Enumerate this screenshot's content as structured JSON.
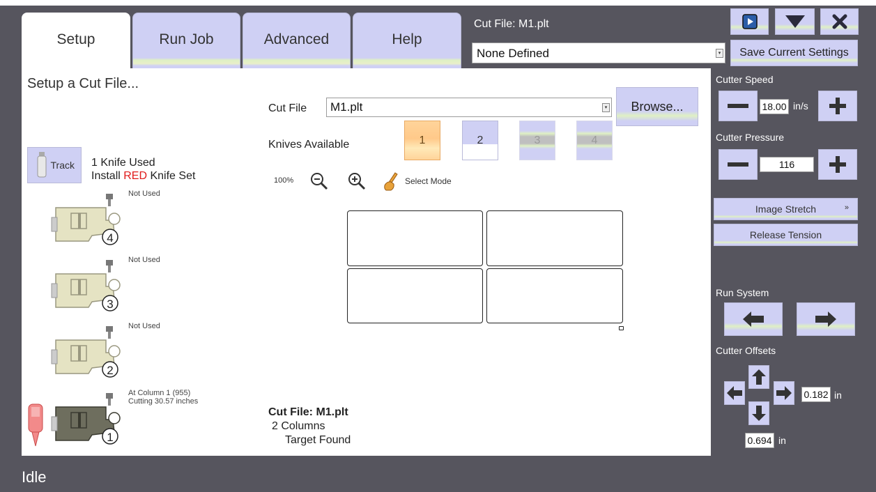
{
  "tabs": [
    {
      "label": "Setup",
      "active": true
    },
    {
      "label": "Run Job",
      "active": false
    },
    {
      "label": "Advanced",
      "active": false
    },
    {
      "label": "Help",
      "active": false
    }
  ],
  "header": {
    "cut_file_title": "Cut File: M1.plt",
    "profile_value": "None Defined",
    "save_settings_label": "Save Current Settings"
  },
  "setup": {
    "title": "Setup a Cut File...",
    "track_label": "Track",
    "knife_used": "1 Knife Used",
    "install_prefix": "Install ",
    "install_color": "RED",
    "install_suffix": " Knife Set"
  },
  "knife_holders": [
    {
      "number": "4",
      "status_line1": "Not Used",
      "status_line2": ""
    },
    {
      "number": "3",
      "status_line1": "Not Used",
      "status_line2": ""
    },
    {
      "number": "2",
      "status_line1": "Not Used",
      "status_line2": ""
    },
    {
      "number": "1",
      "status_line1": "At Column 1 (955)",
      "status_line2": "Cutting 30.57 inches"
    }
  ],
  "cut_file": {
    "label": "Cut File",
    "value": "M1.plt",
    "browse_label": "Browse...",
    "knives_label": "Knives Available",
    "knives": [
      {
        "label": "1",
        "state": "selected"
      },
      {
        "label": "2",
        "state": "available"
      },
      {
        "label": "3",
        "state": "disabled"
      },
      {
        "label": "4",
        "state": "disabled"
      }
    ],
    "zoom_level": "100%",
    "select_mode_label": "Select Mode"
  },
  "summary": {
    "title": "Cut File: M1.plt",
    "columns": "2 Columns",
    "target": "Target Found"
  },
  "controls": {
    "cutter_speed_label": "Cutter Speed",
    "cutter_speed_value": "18.00",
    "cutter_speed_unit": "in/s",
    "cutter_pressure_label": "Cutter Pressure",
    "cutter_pressure_value": "116",
    "image_stretch_label": "Image Stretch",
    "release_tension_label": "Release Tension",
    "run_system_label": "Run System",
    "cutter_offsets_label": "Cutter Offsets",
    "offset_x_value": "0.182",
    "offset_y_value": "0.694",
    "offset_unit": "in"
  },
  "status": {
    "text": "Idle"
  },
  "colors": {
    "background": "#56555e",
    "button": "#cfd0f4",
    "accent_red": "#e01b1b",
    "knife_selected": "#ffc98a"
  }
}
